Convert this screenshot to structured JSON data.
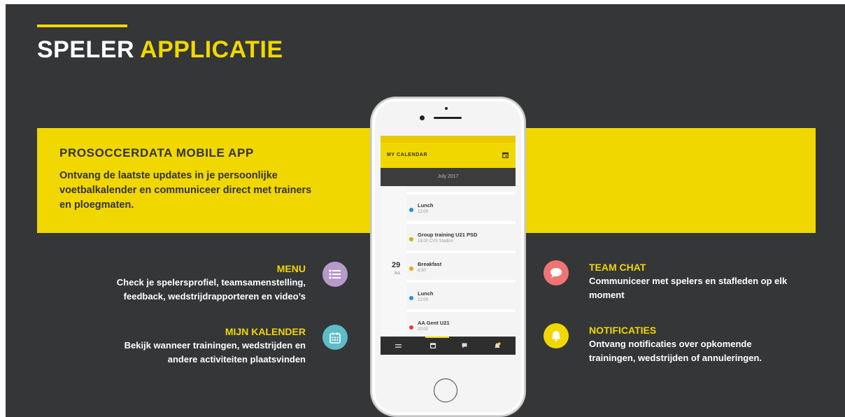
{
  "title": {
    "part1": "SPELER",
    "part2": "APPLICATIE"
  },
  "banner": {
    "title": "PROSOCCERDATA  MOBILE APP",
    "text": "Ontvang de laatste updates in je persoonlijke voetbalkalender en communiceer direct met trainers en ploegmaten."
  },
  "features": {
    "menu": {
      "title": "MENU",
      "line1": "Check je spelersprofiel,  teamsamenstelling,",
      "line2": "feedback, wedstrijdrapporteren  en video’s",
      "icon": "list-icon",
      "color": "#b69ac9"
    },
    "kalender": {
      "title": "MIJN KALENDER",
      "line1": "Bekijk wanneer trainingen, wedstrijden en",
      "line2": "andere activiteiten plaatsvinden",
      "icon": "calendar-icon",
      "color": "#5dbcc7"
    },
    "chat": {
      "title": "TEAM CHAT",
      "line1": "Communiceer met spelers en stafleden op elk",
      "line2": "moment",
      "icon": "chat-bubble-icon",
      "color": "#ef7575"
    },
    "notificaties": {
      "title": "NOTIFICATIES",
      "line1": "Ontvang notificaties  over opkomende",
      "line2": "trainingen, wedstrijden  of annuleringen.",
      "icon": "bell-icon",
      "color": "#f1d700"
    }
  },
  "phone": {
    "appbar_title": "MY CALENDAR",
    "month": "July 2017",
    "day_number": "29",
    "day_month": "JUL",
    "events": [
      {
        "title": "Lunch",
        "sub": "12:00",
        "color": "#2a8bd8"
      },
      {
        "title": "Group training U21 PSD",
        "sub": "18:00   CVS Stadion",
        "color": "#c9b400"
      },
      {
        "title": "Breakfast",
        "sub": "8:30",
        "color": "#f0a020"
      },
      {
        "title": "Lunch",
        "sub": "12:00",
        "color": "#2a8bd8"
      },
      {
        "title": "AA Gent U21",
        "sub": "20:00",
        "color": "#e04040"
      }
    ]
  },
  "colors": {
    "background": "#343638",
    "accent": "#f1d700"
  }
}
